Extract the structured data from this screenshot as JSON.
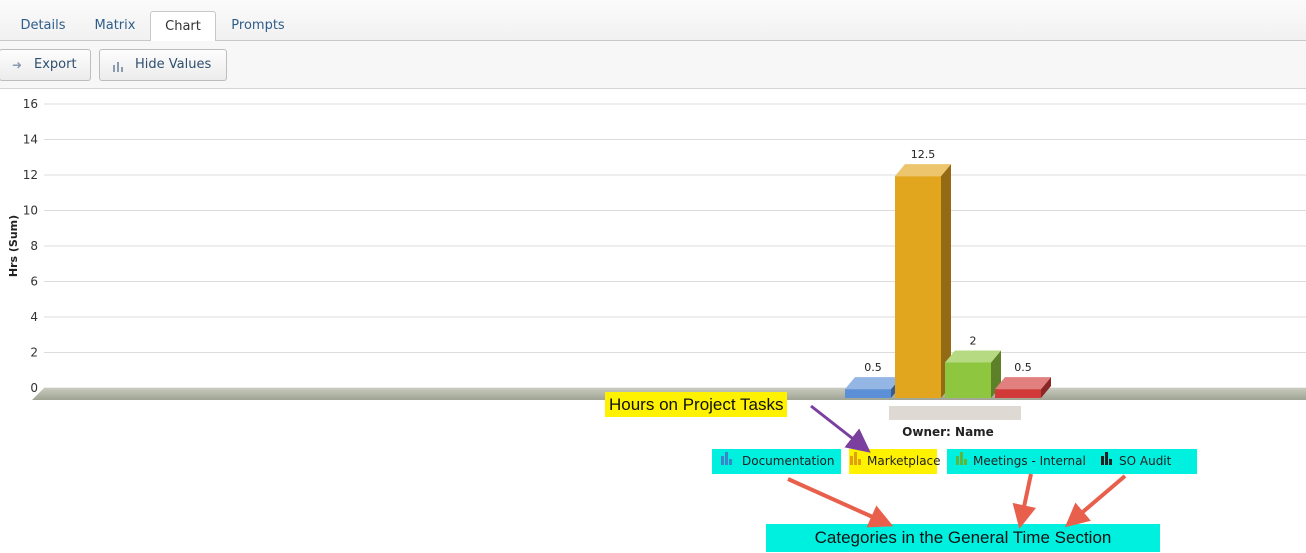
{
  "tabs": [
    {
      "label": "Details",
      "active": false
    },
    {
      "label": "Matrix",
      "active": false
    },
    {
      "label": "Chart",
      "active": true
    },
    {
      "label": "Prompts",
      "active": false
    }
  ],
  "toolbar": {
    "export_label": "Export",
    "export_icon": "arrow-right-icon",
    "hide_values_label": "Hide Values",
    "hide_values_icon": "bar-chart-icon"
  },
  "chart_data": {
    "type": "bar",
    "categories": [
      ""
    ],
    "xlabel": "Owner: Name",
    "ylabel": "Hrs (Sum)",
    "ylim": [
      0,
      16
    ],
    "yticks": [
      0,
      2,
      4,
      6,
      8,
      10,
      12,
      14,
      16
    ],
    "grid": true,
    "legend_position": "bottom",
    "series": [
      {
        "name": "Documentation",
        "values": [
          0.5
        ],
        "value_label": "0.5",
        "color": "#5b8fd6"
      },
      {
        "name": "Marketplace",
        "values": [
          12.5
        ],
        "value_label": "12.5",
        "color": "#e2a51e"
      },
      {
        "name": "Meetings - Internal",
        "values": [
          2
        ],
        "value_label": "2",
        "color": "#8ec63f"
      },
      {
        "name": "SO Audit",
        "values": [
          0.5
        ],
        "value_label": "0.5",
        "color": "#d23a3a"
      }
    ]
  },
  "legend": [
    {
      "label": "Documentation",
      "highlight": "#00f0e0",
      "icon_color": "#3b86c8"
    },
    {
      "label": "Marketplace",
      "highlight": "#fff200",
      "icon_color": "#e0a010"
    },
    {
      "label": "Meetings - Internal",
      "highlight": "#00f0e0",
      "icon_color": "#5cb83a"
    },
    {
      "label": "SO Audit",
      "highlight": "#00f0e0",
      "icon_color": "#222222"
    }
  ],
  "annotations": {
    "hours_note": "Hours on Project Tasks",
    "categories_note": "Categories in the General Time Section",
    "yellow": "#fff200",
    "cyan": "#00f0e0",
    "purple_arrow": "#7b3fa0",
    "red_arrow": "#e8604c"
  }
}
